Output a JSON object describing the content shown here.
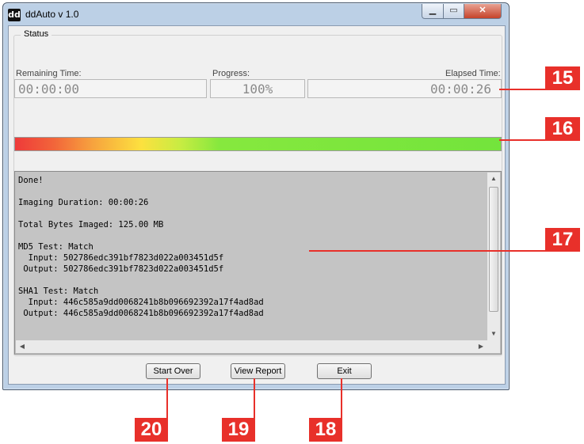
{
  "window": {
    "app_icon": "dd",
    "title": "ddAuto v 1.0",
    "controls": {
      "minimize": "▁",
      "maximize": "▭",
      "close": "✕"
    }
  },
  "status": {
    "group_label": "Status",
    "remaining_label": "Remaining Time:",
    "remaining_value": "00:00:00",
    "progress_label": "Progress:",
    "progress_value": "100%",
    "elapsed_label": "Elapsed Time:",
    "elapsed_value": "00:00:26",
    "progress_fraction": 1.0
  },
  "log": {
    "lines": [
      "Done!",
      "",
      "Imaging Duration: 00:00:26",
      "",
      "Total Bytes Imaged: 125.00 MB",
      "",
      "MD5 Test: Match",
      "  Input: 502786edc391bf7823d022a003451d5f",
      " Output: 502786edc391bf7823d022a003451d5f",
      "",
      "SHA1 Test: Match",
      "  Input: 446c585a9dd0068241b8b096692392a17f4ad8ad",
      " Output: 446c585a9dd0068241b8b096692392a17f4ad8ad"
    ]
  },
  "buttons": {
    "start_over": "Start Over",
    "view_report": "View Report",
    "exit": "Exit"
  },
  "annotations": {
    "c15": "15",
    "c16": "16",
    "c17": "17",
    "c18": "18",
    "c19": "19",
    "c20": "20"
  },
  "colors": {
    "callout": "#e8302a",
    "progress_start": "#ee3a3a",
    "progress_end": "#73e43c"
  }
}
